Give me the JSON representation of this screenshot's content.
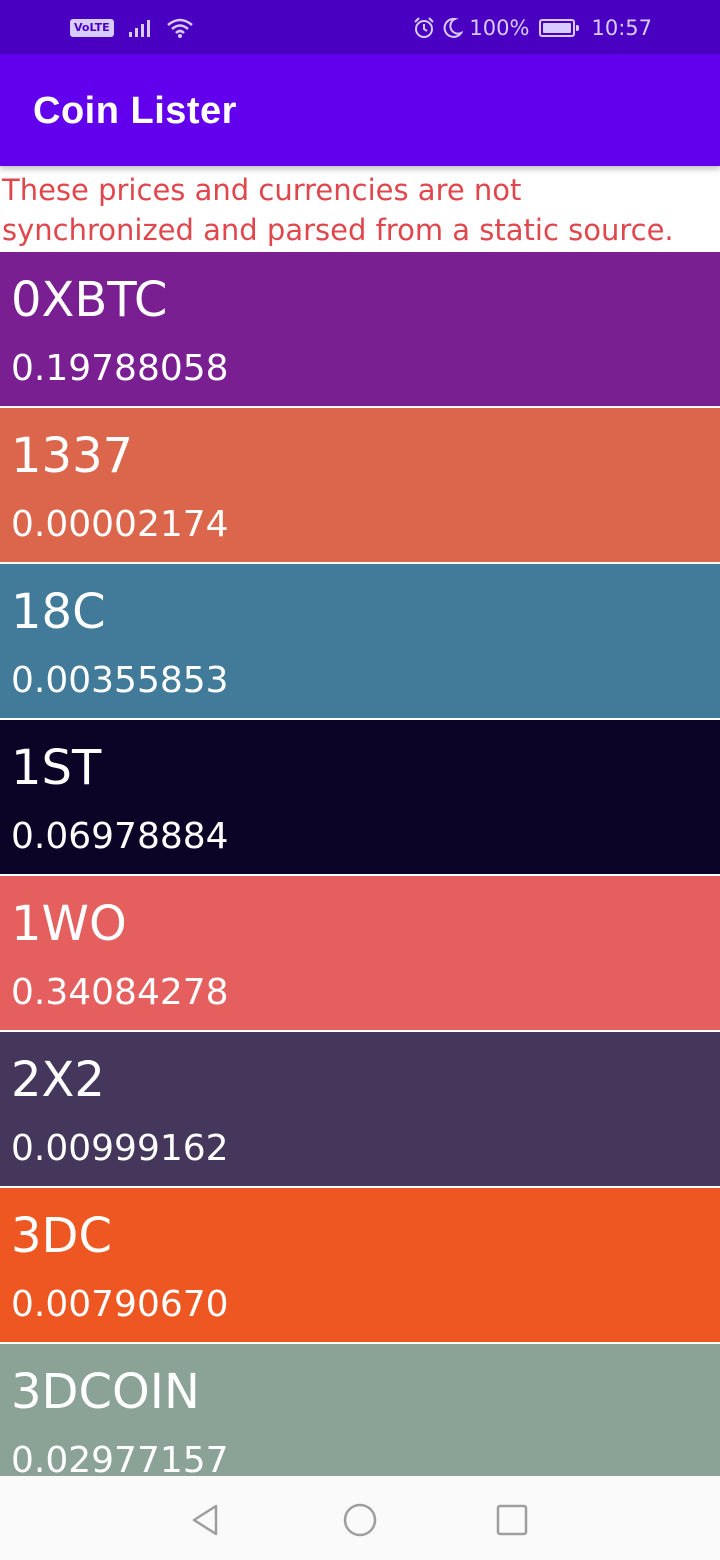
{
  "status_bar": {
    "volte": "VoLTE",
    "battery_percent": "100%",
    "time": "10:57"
  },
  "app_bar": {
    "title": "Coin Lister"
  },
  "notice": "These prices and currencies are not\nsynchronized and parsed from a static source.",
  "coins": [
    {
      "name": "0XBTC",
      "price": "0.19788058",
      "color": "#7a1f91"
    },
    {
      "name": "1337",
      "price": "0.00002174",
      "color": "#dc664c"
    },
    {
      "name": "18C",
      "price": "0.00355853",
      "color": "#427b9a"
    },
    {
      "name": "1ST",
      "price": "0.06978884",
      "color": "#0c0426"
    },
    {
      "name": "1WO",
      "price": "0.34084278",
      "color": "#e65f5f"
    },
    {
      "name": "2X2",
      "price": "0.00999162",
      "color": "#45375c"
    },
    {
      "name": "3DC",
      "price": "0.00790670",
      "color": "#ee5722"
    },
    {
      "name": "3DCOIN",
      "price": "0.02977157",
      "color": "#8ba297"
    }
  ],
  "colors": {
    "status_bar": "#4a00c0",
    "app_bar": "#6200ee",
    "notice_text": "#e0474c"
  },
  "icons": {
    "status_left": [
      "volte-icon",
      "signal-icon",
      "wifi-icon"
    ],
    "status_right": [
      "alarm-icon",
      "moon-icon",
      "battery-icon"
    ],
    "nav": [
      "back-icon",
      "home-icon",
      "recents-icon"
    ]
  }
}
